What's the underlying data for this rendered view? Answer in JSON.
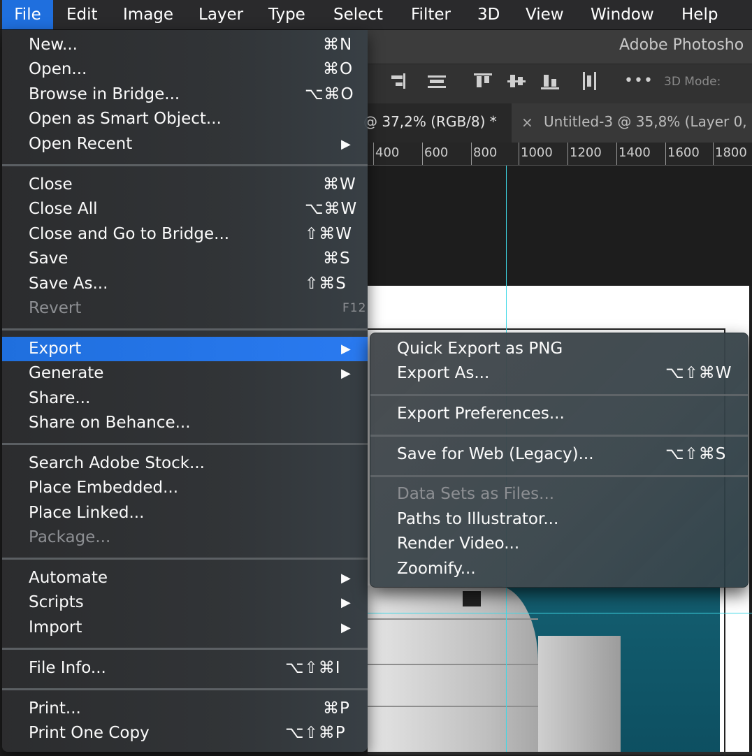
{
  "menubar": {
    "items": [
      "File",
      "Edit",
      "Image",
      "Layer",
      "Type",
      "Select",
      "Filter",
      "3D",
      "View",
      "Window",
      "Help"
    ],
    "active": "File"
  },
  "app": {
    "title": "Adobe Photosho",
    "options": {
      "mode_3d_label": "3D Mode:",
      "more_label": "•••"
    },
    "tabs": [
      {
        "label": "@ 37,2% (RGB/8) *"
      },
      {
        "close": "×",
        "label": "Untitled-3 @ 35,8% (Layer 0,"
      }
    ],
    "ruler": [
      "400",
      "600",
      "800",
      "1000",
      "1200",
      "1400",
      "1600",
      "1800"
    ]
  },
  "file_menu": {
    "items": [
      {
        "label": "New...",
        "shortcut": "⌘N"
      },
      {
        "label": "Open...",
        "shortcut": "⌘O"
      },
      {
        "label": "Browse in Bridge...",
        "shortcut": "⌥⌘O"
      },
      {
        "label": "Open as Smart Object...",
        "shortcut": ""
      },
      {
        "label": "Open Recent",
        "submenu": true
      },
      {
        "label": "Close",
        "shortcut": "⌘W"
      },
      {
        "label": "Close All",
        "shortcut": "⌥⌘W"
      },
      {
        "label": "Close and Go to Bridge...",
        "shortcut": "⇧⌘W"
      },
      {
        "label": "Save",
        "shortcut": "⌘S"
      },
      {
        "label": "Save As...",
        "shortcut": "⇧⌘S"
      },
      {
        "label": "Revert",
        "shortcut": "F12",
        "disabled": true
      },
      {
        "label": "Export",
        "submenu": true,
        "highlighted": true
      },
      {
        "label": "Generate",
        "submenu": true
      },
      {
        "label": "Share...",
        "shortcut": ""
      },
      {
        "label": "Share on Behance...",
        "shortcut": ""
      },
      {
        "label": "Search Adobe Stock...",
        "shortcut": ""
      },
      {
        "label": "Place Embedded...",
        "shortcut": ""
      },
      {
        "label": "Place Linked...",
        "shortcut": ""
      },
      {
        "label": "Package...",
        "shortcut": "",
        "disabled": true
      },
      {
        "label": "Automate",
        "submenu": true
      },
      {
        "label": "Scripts",
        "submenu": true
      },
      {
        "label": "Import",
        "submenu": true
      },
      {
        "label": "File Info...",
        "shortcut": "⌥⇧⌘I"
      },
      {
        "label": "Print...",
        "shortcut": "⌘P"
      },
      {
        "label": "Print One Copy",
        "shortcut": "⌥⇧⌘P"
      }
    ],
    "submenu_arrow": "▶"
  },
  "export_submenu": {
    "items": [
      {
        "label": "Quick Export as PNG",
        "shortcut": ""
      },
      {
        "label": "Export As...",
        "shortcut": "⌥⇧⌘W"
      },
      {
        "label": "Export Preferences...",
        "shortcut": ""
      },
      {
        "label": "Save for Web (Legacy)...",
        "shortcut": "⌥⇧⌘S"
      },
      {
        "label": "Data Sets as Files...",
        "shortcut": "",
        "disabled": true
      },
      {
        "label": "Paths to Illustrator...",
        "shortcut": ""
      },
      {
        "label": "Render Video...",
        "shortcut": ""
      },
      {
        "label": "Zoomify...",
        "shortcut": ""
      }
    ]
  },
  "colors": {
    "highlight": "#1f6fde",
    "guide": "#3fd8e6",
    "photo_bg": "#135e70"
  }
}
